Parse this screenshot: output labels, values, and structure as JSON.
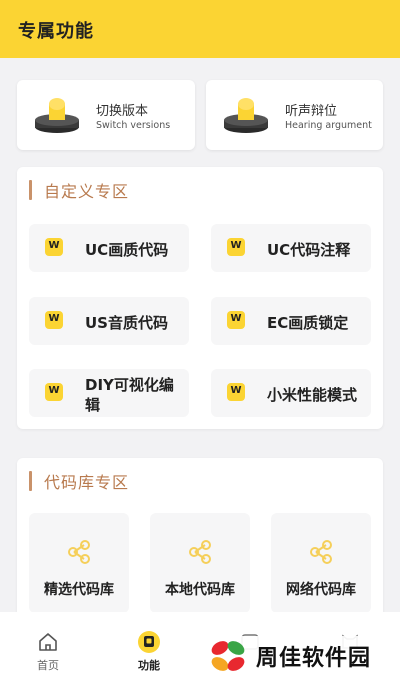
{
  "header": {
    "title": "专属功能"
  },
  "quick": [
    {
      "title": "切换版本",
      "subtitle": "Switch versions"
    },
    {
      "title": "听声辩位",
      "subtitle": "Hearing argument"
    }
  ],
  "custom_section": {
    "title": "自定义专区",
    "badge": "W",
    "items": [
      {
        "label": "UC画质代码"
      },
      {
        "label": "UC代码注释"
      },
      {
        "label": "US音质代码"
      },
      {
        "label": "EC画质锁定"
      },
      {
        "label": "DIY可视化编辑"
      },
      {
        "label": "小米性能模式"
      }
    ]
  },
  "library_section": {
    "title": "代码库专区",
    "items": [
      {
        "label": "精选代码库"
      },
      {
        "label": "本地代码库"
      },
      {
        "label": "网络代码库"
      }
    ]
  },
  "tabbar": {
    "tabs": [
      {
        "label": "首页"
      },
      {
        "label": "功能"
      }
    ]
  },
  "watermark": {
    "text": "周佳软件园"
  },
  "colors": {
    "accent": "#fbd433",
    "section_title": "#b87a4e"
  }
}
